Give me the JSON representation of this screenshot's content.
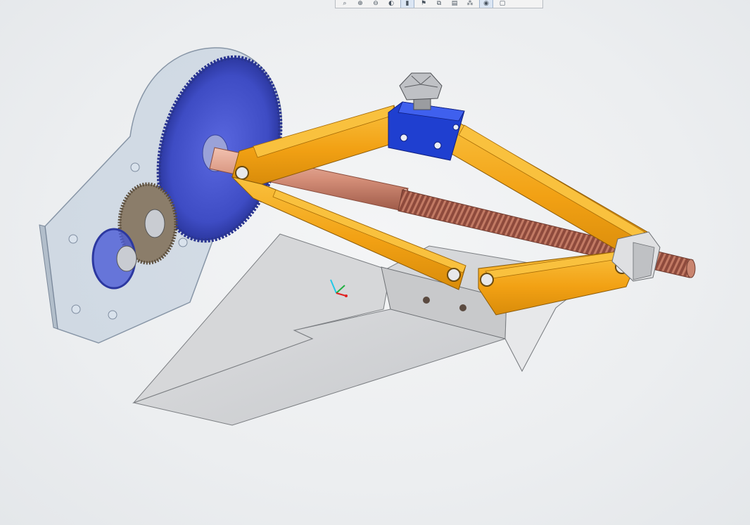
{
  "toolbar": {
    "buttons": [
      {
        "name": "zoom-area-icon",
        "glyph": "⌕"
      },
      {
        "name": "zoom-in-icon",
        "glyph": "⊕"
      },
      {
        "name": "zoom-out-icon",
        "glyph": "⊖"
      },
      {
        "name": "rotate-view-icon",
        "glyph": "◐"
      },
      {
        "name": "select-icon",
        "glyph": "▮",
        "active": true
      },
      {
        "name": "pan-icon",
        "glyph": "⚑"
      },
      {
        "name": "view-orientation-icon",
        "glyph": "⧉"
      },
      {
        "name": "section-view-icon",
        "glyph": "▤"
      },
      {
        "name": "display-style-icon",
        "glyph": "⁂"
      },
      {
        "name": "hide-show-icon",
        "glyph": "◉",
        "active": true
      },
      {
        "name": "appearance-icon",
        "glyph": "▢"
      }
    ]
  },
  "model": {
    "colors": {
      "arm_orange": "#f2a114",
      "arm_orange_light": "#f9c13e",
      "arm_orange_dark": "#c97f08",
      "top_bracket_blue": "#1f3fd0",
      "gear_blue": "#4b5bd6",
      "screw_copper": "#a45a47",
      "rod_copper": "#d89a86",
      "base_plate_gray": "#d5d6d8",
      "housing_glass": "#b9c8d8"
    },
    "triad": {
      "x_color": "#e02020",
      "y_color": "#20b040",
      "z_color": "#20c8e8"
    }
  }
}
